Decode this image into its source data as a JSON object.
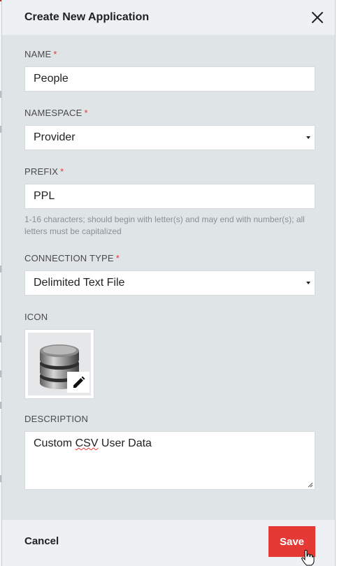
{
  "dialog": {
    "title": "Create New Application",
    "close_icon": "close-icon"
  },
  "form": {
    "name": {
      "label": "NAME",
      "required_mark": "*",
      "value": "People"
    },
    "namespace": {
      "label": "NAMESPACE",
      "required_mark": "*",
      "selected": "Provider"
    },
    "prefix": {
      "label": "PREFIX",
      "required_mark": "*",
      "value": "PPL",
      "hint_line1": "1-16 characters; should begin with letter(s) and may end with number(s); all",
      "hint_line2": "letters must be capitalized"
    },
    "connection_type": {
      "label": "CONNECTION TYPE",
      "required_mark": "*",
      "selected": "Delimited Text File"
    },
    "icon": {
      "label": "ICON",
      "image": "database-icon",
      "edit": "pencil-icon"
    },
    "description": {
      "label": "DESCRIPTION",
      "value_plain": "Custom ",
      "value_misspelled": "CSV",
      "value_rest": " User Data"
    }
  },
  "footer": {
    "cancel_label": "Cancel",
    "save_label": "Save"
  },
  "colors": {
    "accent": "#e53935",
    "dialog_bg": "#dfe4e7",
    "header_bg": "#eef1f3"
  }
}
